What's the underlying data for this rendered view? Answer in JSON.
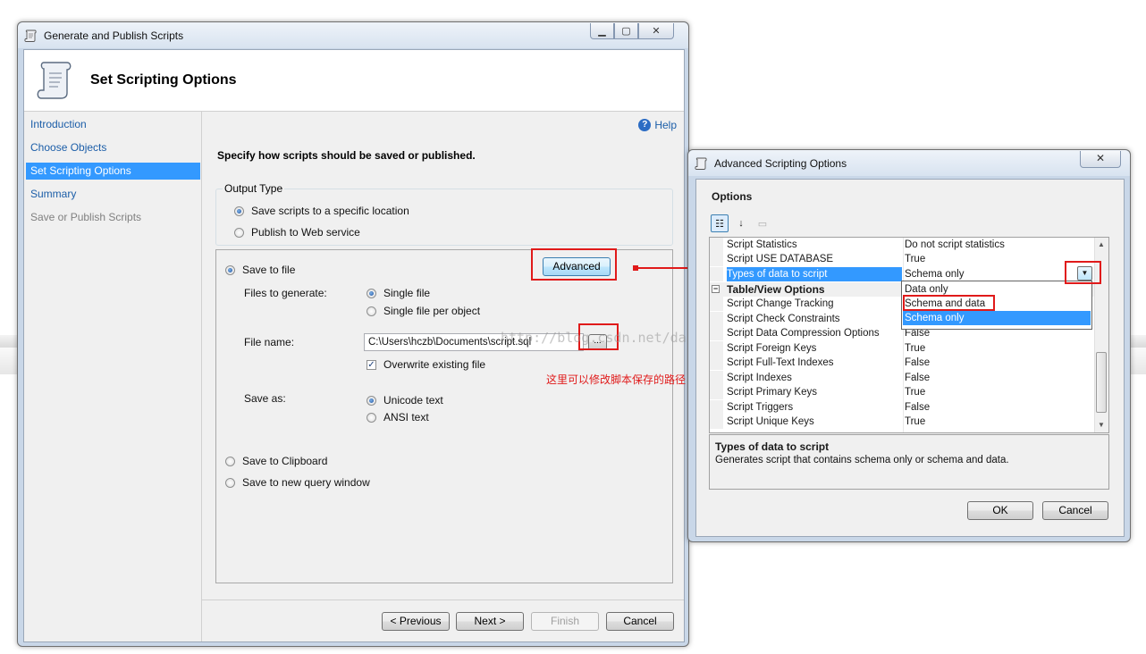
{
  "wizard": {
    "title": "Generate and Publish Scripts",
    "header_title": "Set Scripting Options",
    "help_label": "Help",
    "nav": [
      {
        "label": "Introduction"
      },
      {
        "label": "Choose Objects"
      },
      {
        "label": "Set Scripting Options"
      },
      {
        "label": "Summary"
      },
      {
        "label": "Save or Publish Scripts"
      }
    ],
    "instruction": "Specify how scripts should be saved or published.",
    "output_type": {
      "legend": "Output Type",
      "option_location": "Save scripts to a specific location",
      "option_web": "Publish to Web service"
    },
    "save_to_file": "Save to file",
    "advanced_button": "Advanced",
    "files_to_generate_label": "Files to generate:",
    "single_file": "Single file",
    "single_file_per_object": "Single file per object",
    "file_name_label": "File name:",
    "file_name_value": "C:\\Users\\hczb\\Documents\\script.sql",
    "browse_button": "...",
    "overwrite_label": "Overwrite existing file",
    "save_as_label": "Save as:",
    "unicode_text": "Unicode text",
    "ansi_text": "ANSI text",
    "save_to_clipboard": "Save to Clipboard",
    "save_to_query_window": "Save to new query window",
    "buttons": {
      "previous": "< Previous",
      "next": "Next >",
      "finish": "Finish",
      "cancel": "Cancel"
    }
  },
  "annotation": {
    "note": "这里可以修改脚本保存的路径",
    "watermark": "http://blog.csdn.net/danny_style"
  },
  "advanced": {
    "title": "Advanced Scripting Options",
    "options_label": "Options",
    "rows": [
      {
        "name": "Script Statistics",
        "value": "Do not script statistics"
      },
      {
        "name": "Script USE DATABASE",
        "value": "True"
      },
      {
        "name": "Types of data to script",
        "value": "Schema only"
      },
      {
        "name": "Table/View Options",
        "value": ""
      },
      {
        "name": "Script Change Tracking",
        "value": ""
      },
      {
        "name": "Script Check Constraints",
        "value": ""
      },
      {
        "name": "Script Data Compression Options",
        "value": "False"
      },
      {
        "name": "Script Foreign Keys",
        "value": "True"
      },
      {
        "name": "Script Full-Text Indexes",
        "value": "False"
      },
      {
        "name": "Script Indexes",
        "value": "False"
      },
      {
        "name": "Script Primary Keys",
        "value": "True"
      },
      {
        "name": "Script Triggers",
        "value": "False"
      },
      {
        "name": "Script Unique Keys",
        "value": "True"
      }
    ],
    "dropdown_options": [
      {
        "label": "Data only"
      },
      {
        "label": "Schema and data"
      },
      {
        "label": "Schema only"
      }
    ],
    "description_title": "Types of data to script",
    "description_text": "Generates script that contains schema only or schema and data.",
    "ok_button": "OK",
    "cancel_button": "Cancel"
  },
  "colors": {
    "selection": "#3399ff",
    "link": "#1c5ea8",
    "annotation_red": "#e01a1a"
  }
}
